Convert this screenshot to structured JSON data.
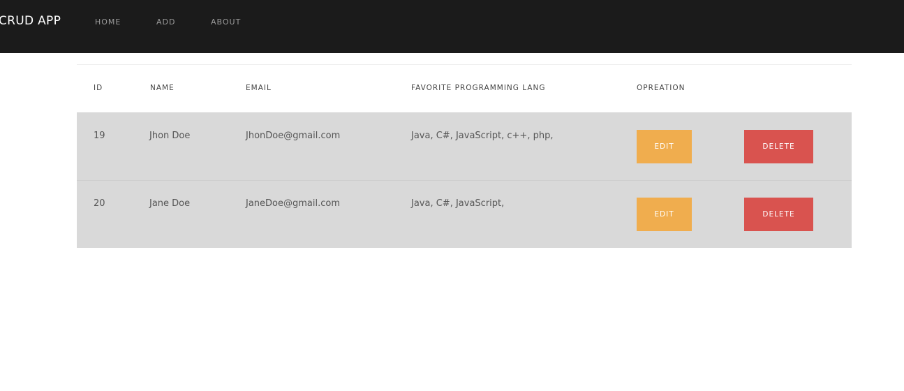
{
  "navbar": {
    "brand": "CRUD APP",
    "links": [
      "HOME",
      "ADD",
      "ABOUT"
    ],
    "bg_color": "#1b1b1b"
  },
  "table": {
    "headers": {
      "id": "ID",
      "name": "NAME",
      "email": "EMAIL",
      "lang": "FAVORITE PROGRAMMING LANG",
      "operation": "OPREATION"
    },
    "rows": [
      {
        "id": "19",
        "name": "Jhon Doe",
        "email": "JhonDoe@gmail.com",
        "lang": "Java, C#, JavaScript, c++, php,",
        "edit_label": "EDIT",
        "delete_label": "DELETE"
      },
      {
        "id": "20",
        "name": "Jane Doe",
        "email": "JaneDoe@gmail.com",
        "lang": "Java, C#, JavaScript,",
        "edit_label": "EDIT",
        "delete_label": "DELETE"
      }
    ]
  },
  "colors": {
    "edit_button": "#f0ad4e",
    "delete_button": "#d9534f",
    "row_bg": "#d9d9d9"
  }
}
